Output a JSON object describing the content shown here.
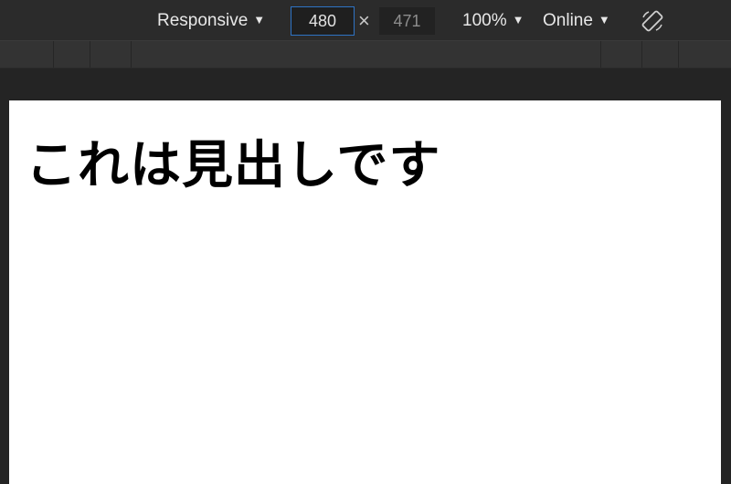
{
  "toolbar": {
    "device_label": "Responsive",
    "width_value": "480",
    "times_sign": "×",
    "height_value": "471",
    "zoom_label": "100%",
    "throttle_label": "Online",
    "dropdown_arrow": "▼"
  },
  "page": {
    "heading": "これは見出しです"
  },
  "colors": {
    "toolbar_bg": "#2b2b2b",
    "input_focus_border": "#2e73c4",
    "viewport_bg": "#ffffff",
    "heading_text": "#000000"
  }
}
